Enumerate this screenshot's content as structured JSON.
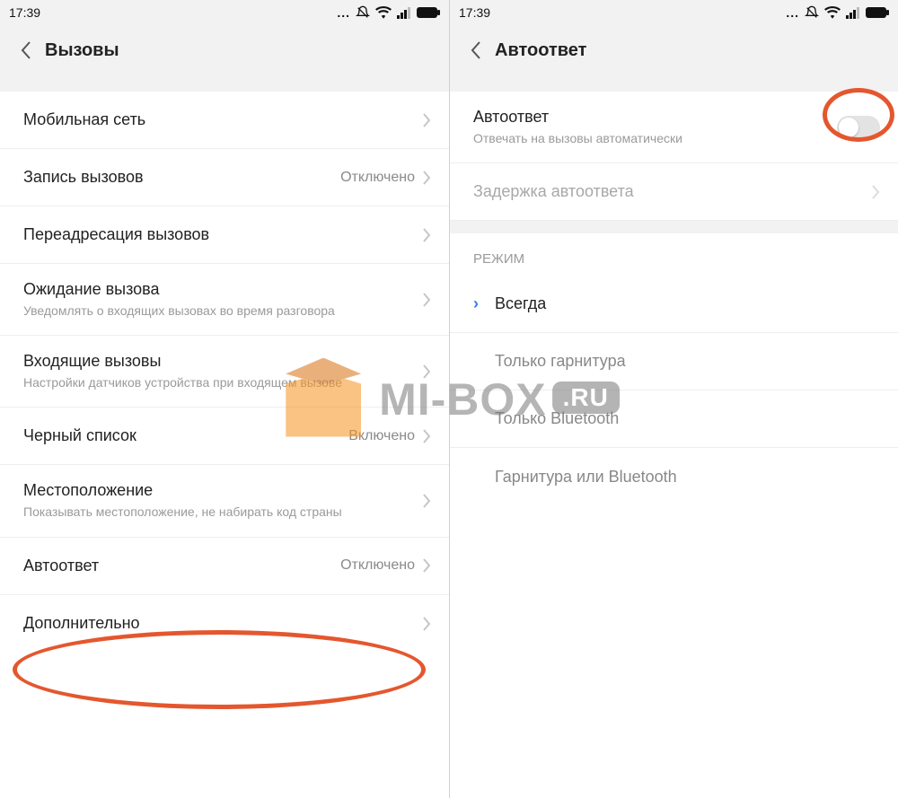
{
  "statusbar": {
    "time": "17:39"
  },
  "left": {
    "title": "Вызовы",
    "items": [
      {
        "label": "Мобильная сеть",
        "value": "",
        "sub": ""
      },
      {
        "label": "Запись вызовов",
        "value": "Отключено",
        "sub": ""
      },
      {
        "label": "Переадресация вызовов",
        "value": "",
        "sub": ""
      },
      {
        "label": "Ожидание вызова",
        "value": "",
        "sub": "Уведомлять о входящих вызовах во время разговора"
      },
      {
        "label": "Входящие вызовы",
        "value": "",
        "sub": "Настройки датчиков устройства при входящем вызове"
      },
      {
        "label": "Черный список",
        "value": "Включено",
        "sub": ""
      },
      {
        "label": "Местоположение",
        "value": "",
        "sub": "Показывать местоположение, не набирать код страны"
      },
      {
        "label": "Автоответ",
        "value": "Отключено",
        "sub": ""
      },
      {
        "label": "Дополнительно",
        "value": "",
        "sub": ""
      }
    ]
  },
  "right": {
    "title": "Автоответ",
    "toggle": {
      "label": "Автоответ",
      "sub": "Отвечать на вызовы автоматически",
      "on": false
    },
    "delay": {
      "label": "Задержка автоответа"
    },
    "section": "РЕЖИМ",
    "options": [
      {
        "label": "Всегда",
        "selected": true
      },
      {
        "label": "Только гарнитура",
        "selected": false
      },
      {
        "label": "Только Bluetooth",
        "selected": false
      },
      {
        "label": "Гарнитура или Bluetooth",
        "selected": false
      }
    ]
  },
  "watermark": {
    "text": "MI-BOX",
    "suffix": ".RU"
  }
}
